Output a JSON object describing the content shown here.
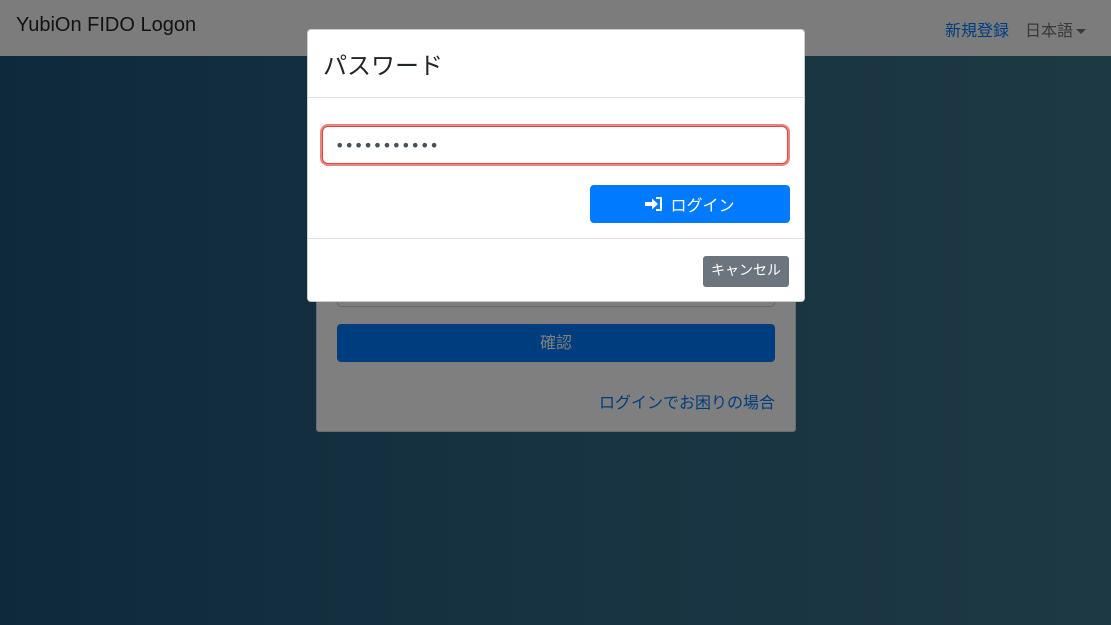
{
  "navbar": {
    "brand": "YubiOn FIDO Logon",
    "register_link": "新規登録",
    "language": "日本語"
  },
  "login_card": {
    "confirm_label": "確認",
    "help_link": "ログインでお困りの場合"
  },
  "modal": {
    "title": "パスワード",
    "password_value": "•••••••••••",
    "login_button": "ログイン",
    "cancel_button": "キャンセル"
  },
  "colors": {
    "primary": "#007bff",
    "secondary": "#6c757d",
    "focus_highlight": "#e04848"
  },
  "icons": {
    "login": "sign-in-icon",
    "language_dropdown": "caret-down-icon"
  }
}
